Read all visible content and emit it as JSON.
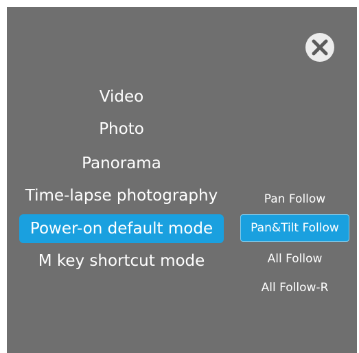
{
  "close": {
    "icon": "close-icon"
  },
  "menu": {
    "items": [
      {
        "label": "Video",
        "selected": false
      },
      {
        "label": "Photo",
        "selected": false
      },
      {
        "label": "Panorama",
        "selected": false
      },
      {
        "label": "Time-lapse photography",
        "selected": false
      },
      {
        "label": "Power-on default mode",
        "selected": true
      },
      {
        "label": "M key shortcut mode",
        "selected": false
      }
    ]
  },
  "submenu": {
    "items": [
      {
        "label": "Pan Follow",
        "selected": false
      },
      {
        "label": "Pan&Tilt Follow",
        "selected": true
      },
      {
        "label": "All Follow",
        "selected": false
      },
      {
        "label": "All Follow-R",
        "selected": false
      }
    ]
  },
  "colors": {
    "panel_bg": "#6f6f6f",
    "accent": "#1aa0df",
    "text": "#ffffff",
    "close_circle": "#ececec"
  }
}
